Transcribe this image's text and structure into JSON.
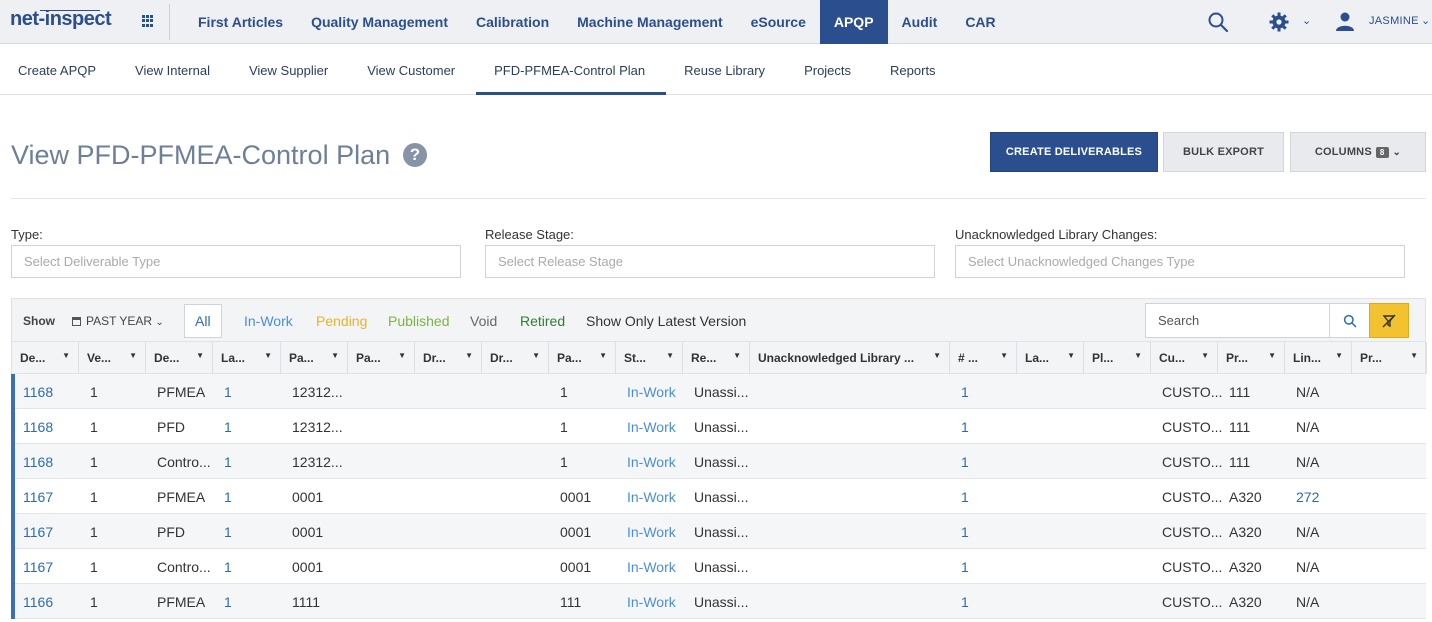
{
  "app": {
    "logo": "net-inspect",
    "user": "JASMINE"
  },
  "main_nav": [
    {
      "label": "First Articles",
      "active": false
    },
    {
      "label": "Quality Management",
      "active": false
    },
    {
      "label": "Calibration",
      "active": false
    },
    {
      "label": "Machine Management",
      "active": false
    },
    {
      "label": "eSource",
      "active": false
    },
    {
      "label": "APQP",
      "active": true
    },
    {
      "label": "Audit",
      "active": false
    },
    {
      "label": "CAR",
      "active": false
    }
  ],
  "sub_nav": [
    {
      "label": "Create APQP",
      "active": false
    },
    {
      "label": "View Internal",
      "active": false
    },
    {
      "label": "View Supplier",
      "active": false
    },
    {
      "label": "View Customer",
      "active": false
    },
    {
      "label": "PFD-PFMEA-Control Plan",
      "active": true
    },
    {
      "label": "Reuse Library",
      "active": false
    },
    {
      "label": "Projects",
      "active": false
    },
    {
      "label": "Reports",
      "active": false
    }
  ],
  "page": {
    "title": "View PFD-PFMEA-Control Plan",
    "help": "?",
    "create_button": "CREATE DELIVERABLES",
    "export_button": "BULK EXPORT",
    "columns_button": "COLUMNS",
    "columns_count": "8"
  },
  "filters": {
    "type_label": "Type:",
    "type_placeholder": "Select Deliverable Type",
    "stage_label": "Release Stage:",
    "stage_placeholder": "Select Release Stage",
    "changes_label": "Unacknowledged Library Changes:",
    "changes_placeholder": "Select Unacknowledged Changes Type"
  },
  "toolbar": {
    "show": "Show",
    "period": "PAST YEAR",
    "tabs": [
      {
        "label": "All",
        "color": "#2b6cb0"
      },
      {
        "label": "In-Work",
        "color": "#4a8fd4"
      },
      {
        "label": "Pending",
        "color": "#e8b42a"
      },
      {
        "label": "Published",
        "color": "#7cb342"
      },
      {
        "label": "Void",
        "color": "#666666"
      },
      {
        "label": "Retired",
        "color": "#2e7d32"
      },
      {
        "label": "Show Only Latest Version",
        "color": "#333333"
      }
    ],
    "search_placeholder": "Search"
  },
  "columns": [
    "De...",
    "Ve...",
    "De...",
    "La...",
    "Pa...",
    "Pa...",
    "Dr...",
    "Dr...",
    "Pa...",
    "St...",
    "Re...",
    "Unacknowledged Library ...",
    "# ...",
    "La...",
    "Pl...",
    "Cu...",
    "Pr...",
    "Lin...",
    "Pr..."
  ],
  "rows": [
    [
      "1168",
      "1",
      "PFMEA",
      "1",
      "12312...",
      "",
      "",
      "",
      "1",
      "In-Work",
      "Unassi...",
      "",
      "1",
      "",
      "",
      "CUSTO...",
      "111",
      "N/A",
      ""
    ],
    [
      "1168",
      "1",
      "PFD",
      "1",
      "12312...",
      "",
      "",
      "",
      "1",
      "In-Work",
      "Unassi...",
      "",
      "1",
      "",
      "",
      "CUSTO...",
      "111",
      "N/A",
      ""
    ],
    [
      "1168",
      "1",
      "Contro...",
      "1",
      "12312...",
      "",
      "",
      "",
      "1",
      "In-Work",
      "Unassi...",
      "",
      "1",
      "",
      "",
      "CUSTO...",
      "111",
      "N/A",
      ""
    ],
    [
      "1167",
      "1",
      "PFMEA",
      "1",
      "0001",
      "",
      "",
      "",
      "0001",
      "In-Work",
      "Unassi...",
      "",
      "1",
      "",
      "",
      "CUSTO...",
      "A320",
      "272",
      ""
    ],
    [
      "1167",
      "1",
      "PFD",
      "1",
      "0001",
      "",
      "",
      "",
      "0001",
      "In-Work",
      "Unassi...",
      "",
      "1",
      "",
      "",
      "CUSTO...",
      "A320",
      "N/A",
      ""
    ],
    [
      "1167",
      "1",
      "Contro...",
      "1",
      "0001",
      "",
      "",
      "",
      "0001",
      "In-Work",
      "Unassi...",
      "",
      "1",
      "",
      "",
      "CUSTO...",
      "A320",
      "N/A",
      ""
    ],
    [
      "1166",
      "1",
      "PFMEA",
      "1",
      "1111",
      "",
      "",
      "",
      "111",
      "In-Work",
      "Unassi...",
      "",
      "1",
      "",
      "",
      "CUSTO...",
      "A320",
      "N/A",
      ""
    ]
  ]
}
